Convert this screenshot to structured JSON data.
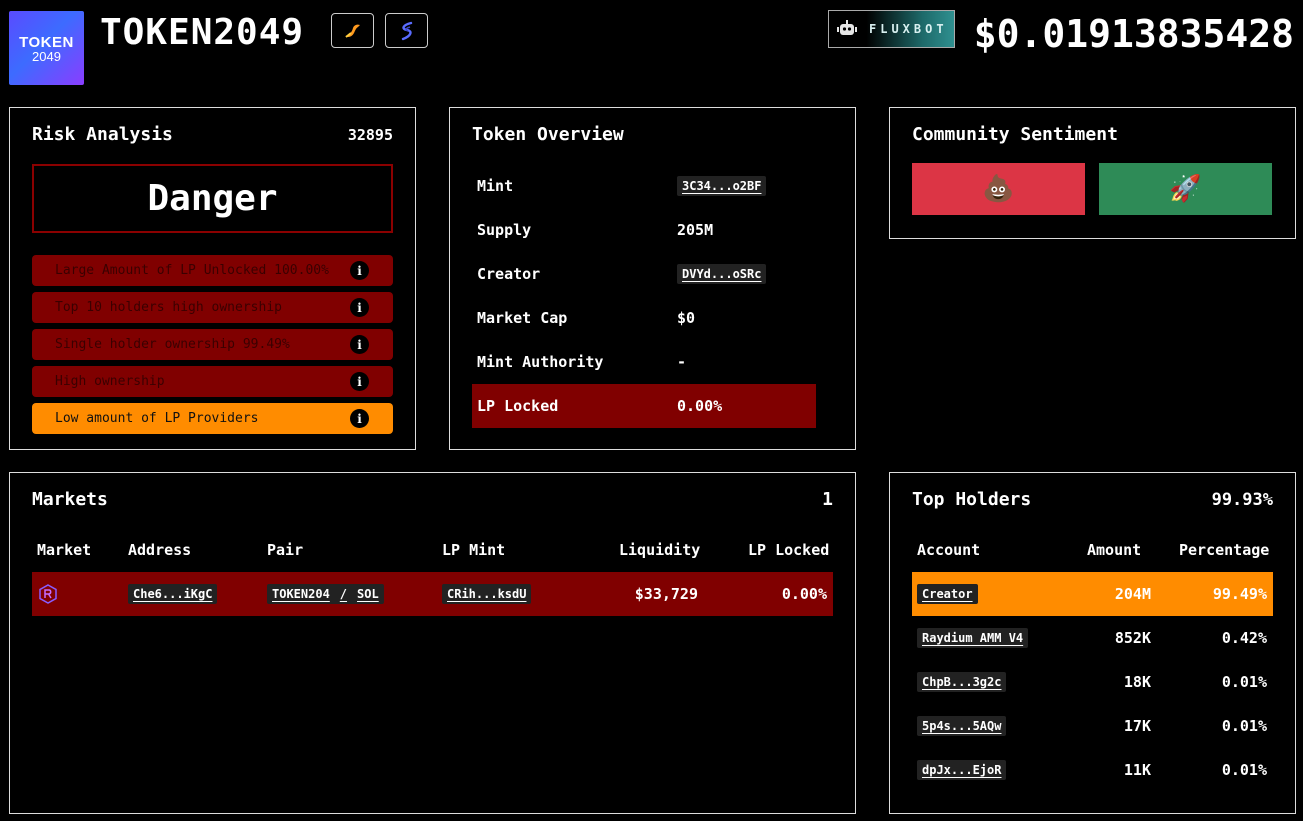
{
  "header": {
    "logo_line1": "TOKEN",
    "logo_line2": "2049",
    "token_name": "TOKEN2049",
    "fluxbot_label": "FLUXBOT",
    "price": "$0.01913835428"
  },
  "icons": {
    "bird": "bird-icon",
    "swirl": "swirl-icon",
    "robot": "robot-icon",
    "info": "info-icon",
    "raydium": "raydium-icon"
  },
  "colors": {
    "danger": "#800000",
    "warn": "#ff8c00",
    "bearish": "#dc3545",
    "bullish": "#2e8b57"
  },
  "risk": {
    "title": "Risk Analysis",
    "score": "32895",
    "level": "Danger",
    "items": [
      {
        "label": "Large Amount of LP Unlocked 100.00%",
        "info": "i"
      },
      {
        "label": "Top 10 holders high ownership",
        "info": "i"
      },
      {
        "label": "Single holder ownership 99.49%",
        "info": "i"
      },
      {
        "label": "High ownership",
        "info": "i"
      },
      {
        "label": "Low amount of LP Providers",
        "info": "i"
      }
    ]
  },
  "overview": {
    "title": "Token Overview",
    "rows": [
      {
        "key": "Mint",
        "value": "3C34...o2BF"
      },
      {
        "key": "Supply",
        "value": "205M"
      },
      {
        "key": "Creator",
        "value": "DVYd...oSRc"
      },
      {
        "key": "Market Cap",
        "value": "$0"
      },
      {
        "key": "Mint Authority",
        "value": "-"
      },
      {
        "key": "LP Locked",
        "value": "0.00%"
      }
    ]
  },
  "sentiment": {
    "title": "Community Sentiment",
    "bearish": "💩",
    "bullish": "🚀"
  },
  "markets": {
    "title": "Markets",
    "count": "1",
    "headers": [
      "Market",
      "Address",
      "Pair",
      "LP Mint",
      "Liquidity",
      "LP Locked"
    ],
    "rows": [
      {
        "address": "Che6...iKgC",
        "pair_base": "TOKEN204",
        "pair_sep": "/",
        "pair_quote": "SOL",
        "lp_mint": "CRih...ksdU",
        "liquidity": "$33,729",
        "lp_locked": "0.00%"
      }
    ]
  },
  "holders": {
    "title": "Top Holders",
    "total": "99.93%",
    "headers": [
      "Account",
      "Amount",
      "Percentage"
    ],
    "rows": [
      {
        "account": "Creator",
        "amount": "204M",
        "pct": "99.49%"
      },
      {
        "account": "Raydium AMM V4",
        "amount": "852K",
        "pct": "0.42%"
      },
      {
        "account": "ChpB...3g2c",
        "amount": "18K",
        "pct": "0.01%"
      },
      {
        "account": "5p4s...5AQw",
        "amount": "17K",
        "pct": "0.01%"
      },
      {
        "account": "dpJx...EjoR",
        "amount": "11K",
        "pct": "0.01%"
      }
    ]
  }
}
